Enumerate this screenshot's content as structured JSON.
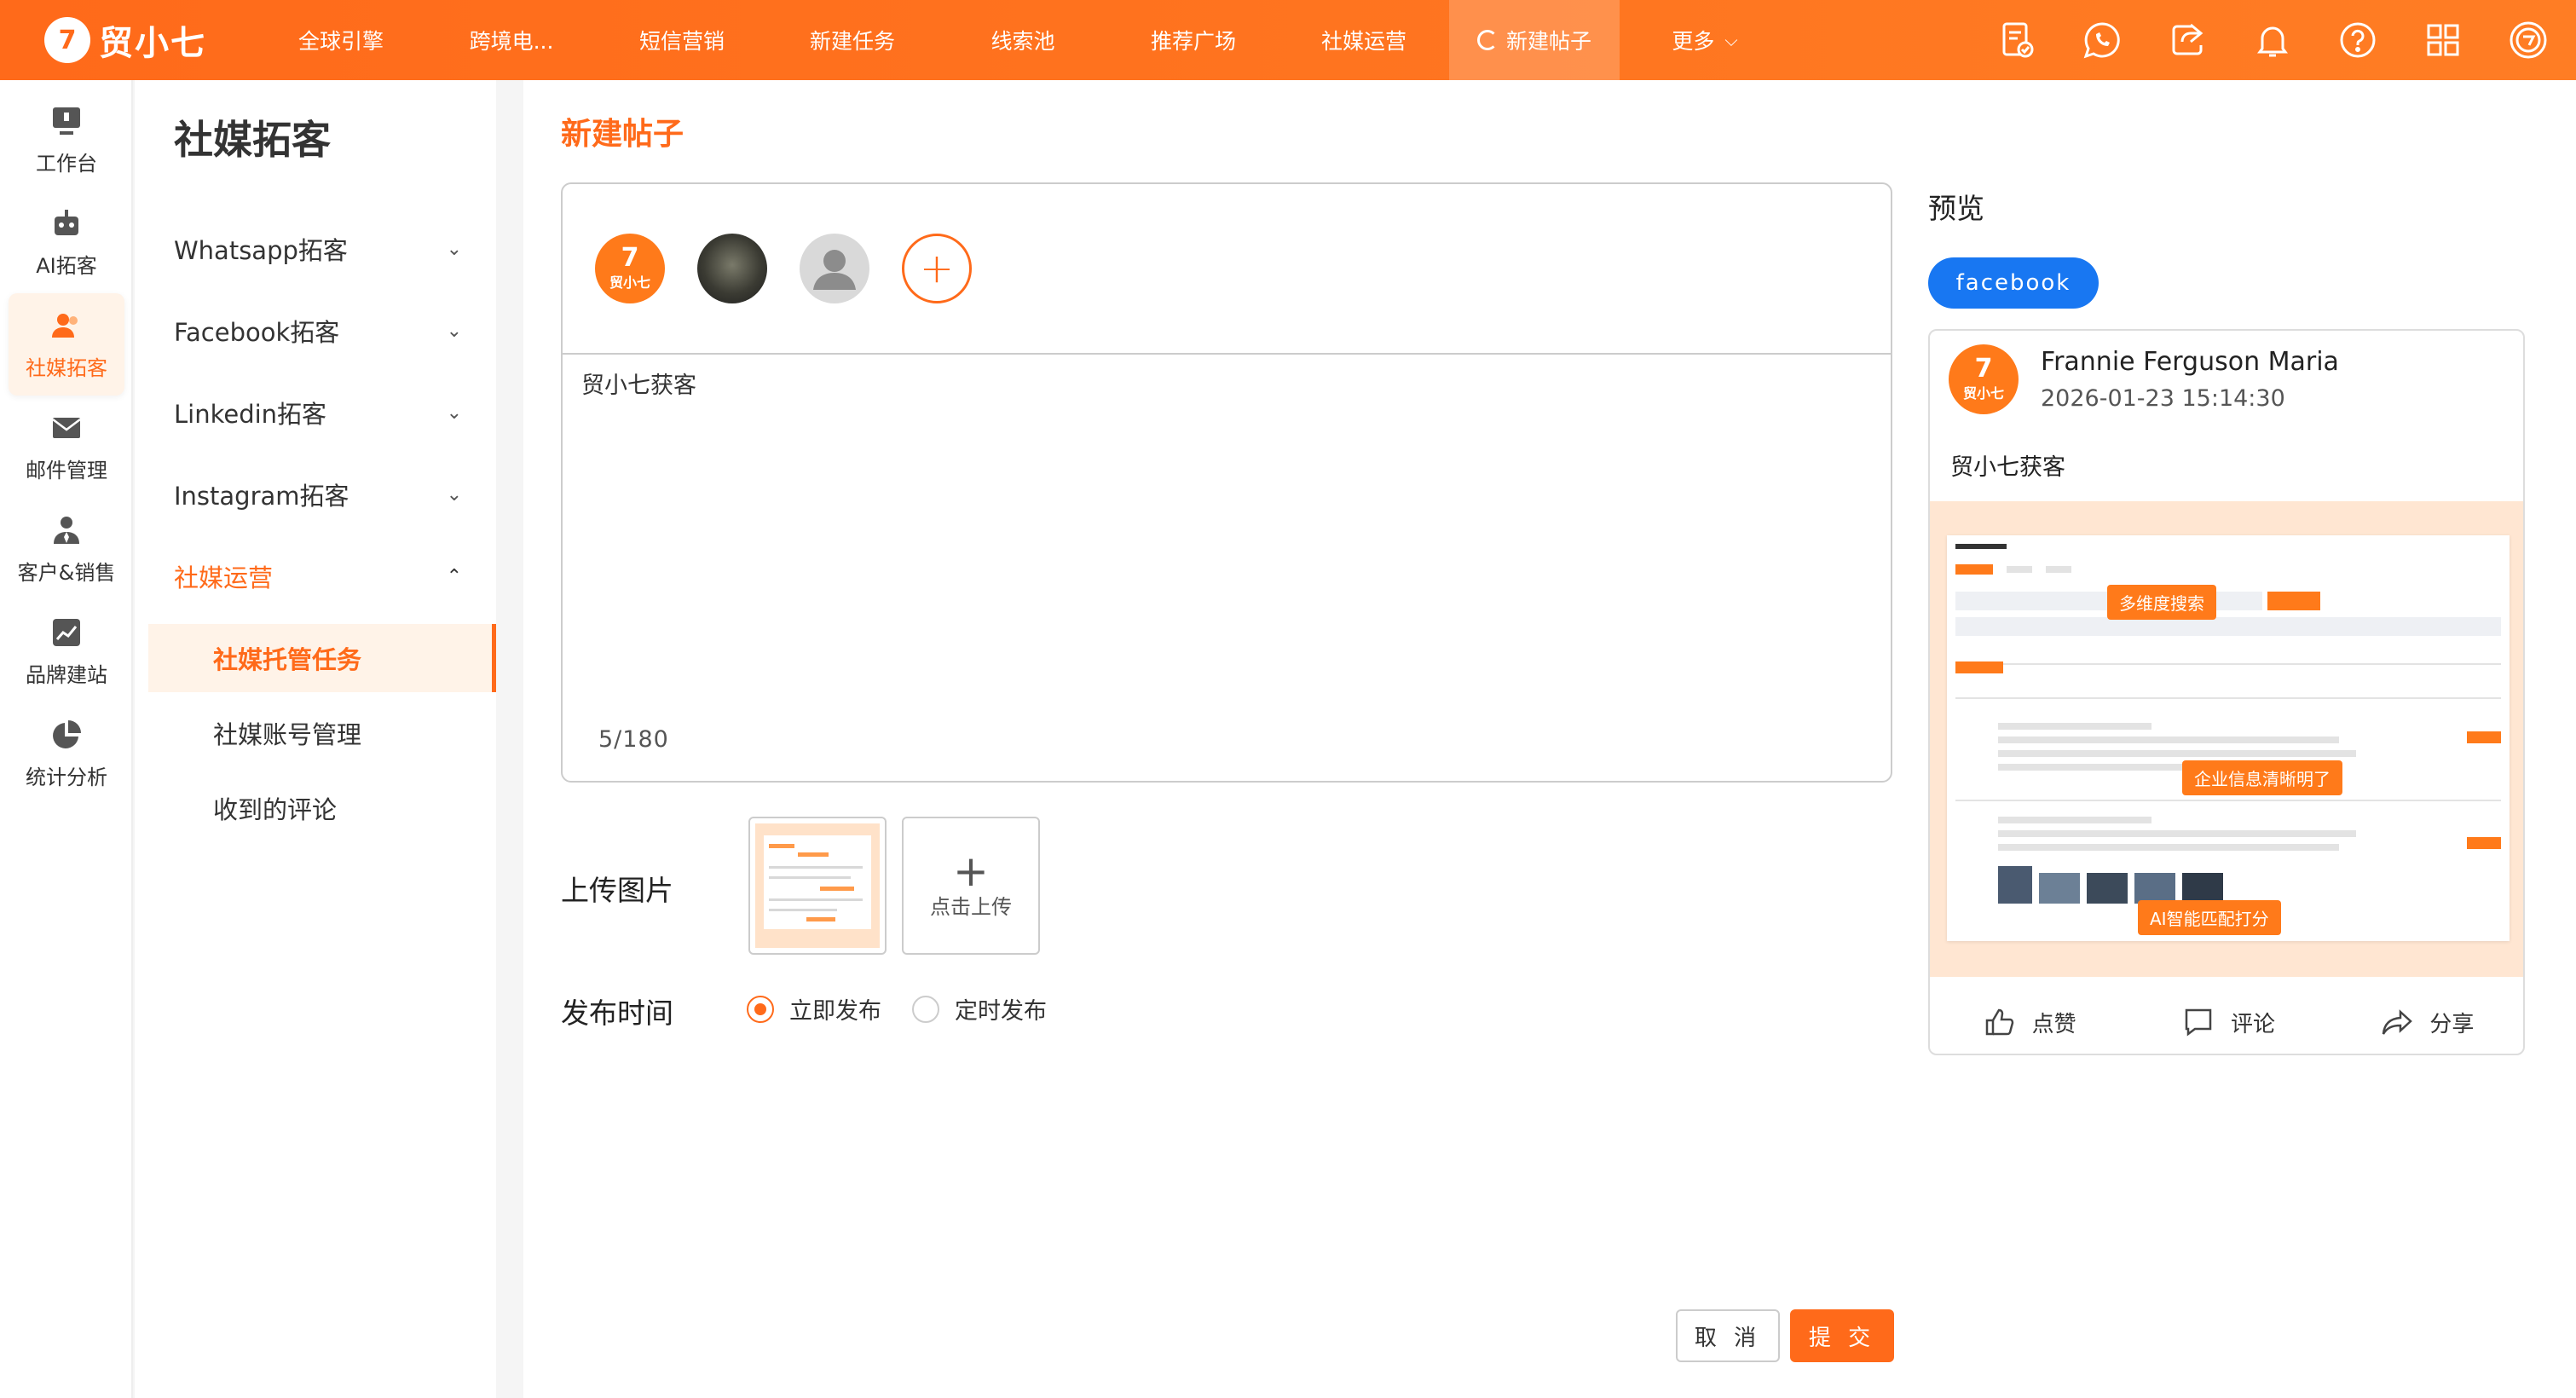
{
  "app": {
    "brand": "贸小七",
    "logo_glyph": "7"
  },
  "nav": {
    "items": [
      "全球引擎",
      "跨境电...",
      "短信营销",
      "新建任务",
      "线索池",
      "推荐广场",
      "社媒运营",
      "新建帖子",
      "更多"
    ],
    "active": "新建帖子"
  },
  "rail": {
    "items": [
      "工作台",
      "AI拓客",
      "社媒拓客",
      "邮件管理",
      "客户&销售",
      "品牌建站",
      "统计分析"
    ],
    "active": "社媒拓客"
  },
  "sidebar": {
    "title": "社媒拓客",
    "groups": [
      "Whatsapp拓客",
      "Facebook拓客",
      "Linkedin拓客",
      "Instagram拓客",
      "社媒运营"
    ],
    "sub_items": [
      "社媒托管任务",
      "社媒账号管理",
      "收到的评论"
    ],
    "active_sub": "社媒托管任务"
  },
  "page": {
    "title": "新建帖子",
    "content": "贸小七获客",
    "counter": "5/180",
    "upload_label": "上传图片",
    "upload_button": "点击上传",
    "publish_label": "发布时间",
    "publish_options": [
      "立即发布",
      "定时发布"
    ],
    "publish_selected": "立即发布",
    "cancel": "取 消",
    "submit": "提 交"
  },
  "preview": {
    "title": "预览",
    "platform": "facebook",
    "author": "Frannie Ferguson Maria",
    "time": "2026-01-23 15:14:30",
    "text": "贸小七获客",
    "image_tags": [
      "多维度搜索",
      "企业信息清晰明了",
      "AI智能匹配打分"
    ],
    "actions": [
      "点赞",
      "评论",
      "分享"
    ]
  },
  "colors": {
    "accent": "#ff6a1a",
    "facebook": "#1877f2"
  }
}
